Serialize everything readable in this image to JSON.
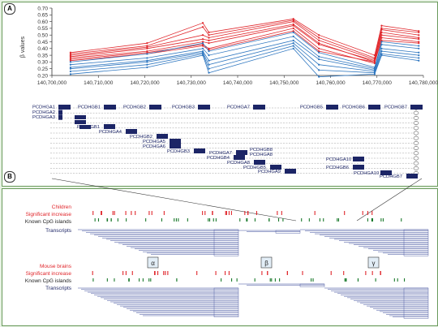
{
  "panel_a": {
    "label": "A",
    "ylabel": "β values",
    "yticks": [
      "0.20",
      "0.25",
      "0.30",
      "0.35",
      "0.40",
      "0.45",
      "0.50",
      "0.55",
      "0.60",
      "0.65",
      "0.70"
    ],
    "xticks": [
      "140,700,000",
      "140,710,000",
      "140,720,000",
      "140,730,000",
      "140,740,000",
      "140,750,000",
      "140,760,000",
      "140,770,000",
      "140,780,000"
    ],
    "genes": {
      "row1": [
        "PCDHGA1",
        "PCDHGB1",
        "PCDHGB2",
        "PCDHGB3",
        "PCDHGA7",
        "PCDHGB5",
        "PCDHGB6",
        "PCDHGB7"
      ],
      "stack": [
        "PCDHGA2",
        "PCDHGA3"
      ],
      "diag": [
        "PCDHGB1",
        "PCDHGA4",
        "PCDHGB2",
        "PCDHGA5",
        "PCDHGA6",
        "PCDHGB3",
        "PCDHGA7",
        "PCDHGB4",
        "PCDHGA8",
        "PCDHGB5",
        "PCDHGA9",
        "PCDHGA10",
        "PCDHGB6",
        "PCDHGA10",
        "PCDHGB7"
      ],
      "diag_mid": [
        "PCDHGB8",
        "PCDHGA8"
      ]
    }
  },
  "panel_b": {
    "label": "B",
    "track_children": "Children",
    "track_sig1": "Significant increase",
    "track_cpg1": "Known CpG islands",
    "track_tx1": "Transcripts",
    "track_mouse": "Mouse brains",
    "track_sig2": "Significant increase",
    "track_cpg2": "Known CpG islands",
    "track_tx2": "Transcripts",
    "clusters": [
      "α",
      "β",
      "γ"
    ]
  },
  "colors": {
    "red": "#e0262b",
    "blue": "#2f77c0",
    "navy": "#1c2566",
    "axis": "#333333"
  },
  "chart_data": {
    "type": "line",
    "xlabel": "",
    "ylabel": "β values",
    "ylim": [
      0.2,
      0.7
    ],
    "xlim": [
      140700000,
      140780000
    ],
    "x": [
      140704000,
      140720500,
      140732500,
      140733800,
      140752000,
      140757500,
      140769500,
      140771000,
      140779000
    ],
    "series": [
      {
        "group": "red",
        "values": [
          0.37,
          0.44,
          0.59,
          0.52,
          0.62,
          0.5,
          0.35,
          0.57,
          0.53
        ]
      },
      {
        "group": "red",
        "values": [
          0.36,
          0.42,
          0.56,
          0.5,
          0.61,
          0.48,
          0.33,
          0.55,
          0.52
        ]
      },
      {
        "group": "red",
        "values": [
          0.35,
          0.41,
          0.5,
          0.48,
          0.6,
          0.46,
          0.32,
          0.54,
          0.5
        ]
      },
      {
        "group": "red",
        "values": [
          0.34,
          0.4,
          0.47,
          0.46,
          0.58,
          0.44,
          0.3,
          0.52,
          0.48
        ]
      },
      {
        "group": "red",
        "values": [
          0.33,
          0.38,
          0.45,
          0.44,
          0.57,
          0.43,
          0.31,
          0.5,
          0.47
        ]
      },
      {
        "group": "red",
        "values": [
          0.32,
          0.37,
          0.43,
          0.4,
          0.55,
          0.4,
          0.29,
          0.48,
          0.45
        ]
      },
      {
        "group": "red",
        "values": [
          0.31,
          0.36,
          0.42,
          0.39,
          0.53,
          0.38,
          0.3,
          0.46,
          0.44
        ]
      },
      {
        "group": "blue",
        "values": [
          0.3,
          0.36,
          0.44,
          0.38,
          0.52,
          0.37,
          0.26,
          0.45,
          0.42
        ]
      },
      {
        "group": "blue",
        "values": [
          0.28,
          0.33,
          0.4,
          0.35,
          0.49,
          0.34,
          0.25,
          0.43,
          0.4
        ]
      },
      {
        "group": "blue",
        "values": [
          0.26,
          0.31,
          0.38,
          0.31,
          0.46,
          0.32,
          0.24,
          0.4,
          0.37
        ]
      },
      {
        "group": "blue",
        "values": [
          0.25,
          0.3,
          0.37,
          0.28,
          0.44,
          0.28,
          0.23,
          0.38,
          0.35
        ]
      },
      {
        "group": "blue",
        "values": [
          0.23,
          0.28,
          0.36,
          0.25,
          0.42,
          0.24,
          0.22,
          0.36,
          0.33
        ]
      },
      {
        "group": "blue",
        "values": [
          0.21,
          0.26,
          0.35,
          0.22,
          0.4,
          0.19,
          0.21,
          0.35,
          0.31
        ]
      }
    ]
  }
}
